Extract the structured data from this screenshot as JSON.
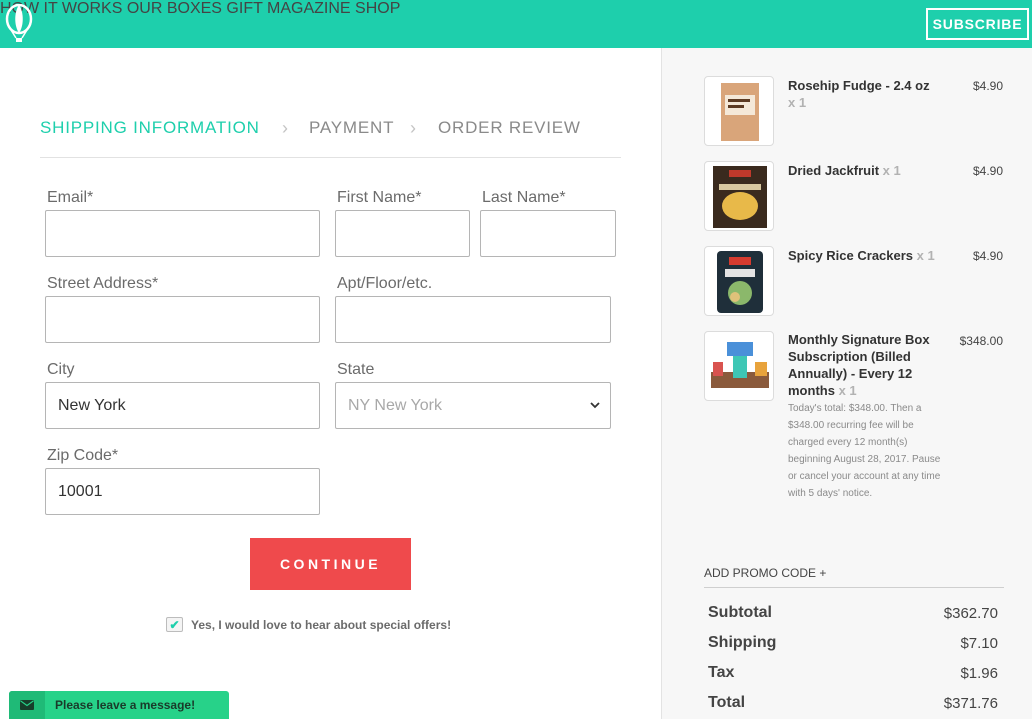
{
  "header": {
    "logo_icon": "hot-air-balloon-icon",
    "nav": [
      "HOW IT WORKS",
      "OUR BOXES",
      "GIFT",
      "MAGAZINE",
      "SHOP"
    ],
    "subscribe": "SUBSCRIBE",
    "brand_color": "#1ecfac"
  },
  "steps": {
    "shipping": "SHIPPING INFORMATION",
    "payment": "PAYMENT",
    "review": "ORDER REVIEW"
  },
  "form": {
    "email_label": "Email*",
    "email_value": "",
    "first_name_label": "First Name*",
    "first_name_value": "",
    "last_name_label": "Last Name*",
    "last_name_value": "",
    "street_label": "Street Address*",
    "street_value": "",
    "apt_label": "Apt/Floor/etc.",
    "apt_value": "",
    "city_label": "City",
    "city_value": "New York",
    "state_label": "State",
    "state_value": "NY New York",
    "zip_label": "Zip Code*",
    "zip_value": "10001",
    "continue": "CONTINUE",
    "optin_checked": true,
    "optin_text": "Yes, I would love to hear about special offers!"
  },
  "chat": {
    "text": "Please leave a message!",
    "icon": "envelope-icon"
  },
  "cart": {
    "items": [
      {
        "name": "Rosehip Fudge - 2.4 oz",
        "qty": "x 1",
        "price": "$4.90"
      },
      {
        "name": "Dried Jackfruit",
        "qty": "x 1",
        "price": "$4.90"
      },
      {
        "name": "Spicy Rice Crackers",
        "qty": "x 1",
        "price": "$4.90"
      },
      {
        "name": "Monthly Signature Box Subscription (Billed Annually) - Every 12 months",
        "qty": "x 1",
        "price": "$348.00"
      }
    ],
    "subscription_note": "Today's total: $348.00. Then a $348.00 recurring fee will be charged every 12 month(s) beginning August 28, 2017. Pause or cancel your account at any time with 5 days' notice.",
    "promo": "ADD PROMO CODE +",
    "summary": {
      "subtotal_label": "Subtotal",
      "subtotal": "$362.70",
      "shipping_label": "Shipping",
      "shipping": "$7.10",
      "tax_label": "Tax",
      "tax": "$1.96",
      "total_label": "Total",
      "total": "$371.76"
    }
  }
}
